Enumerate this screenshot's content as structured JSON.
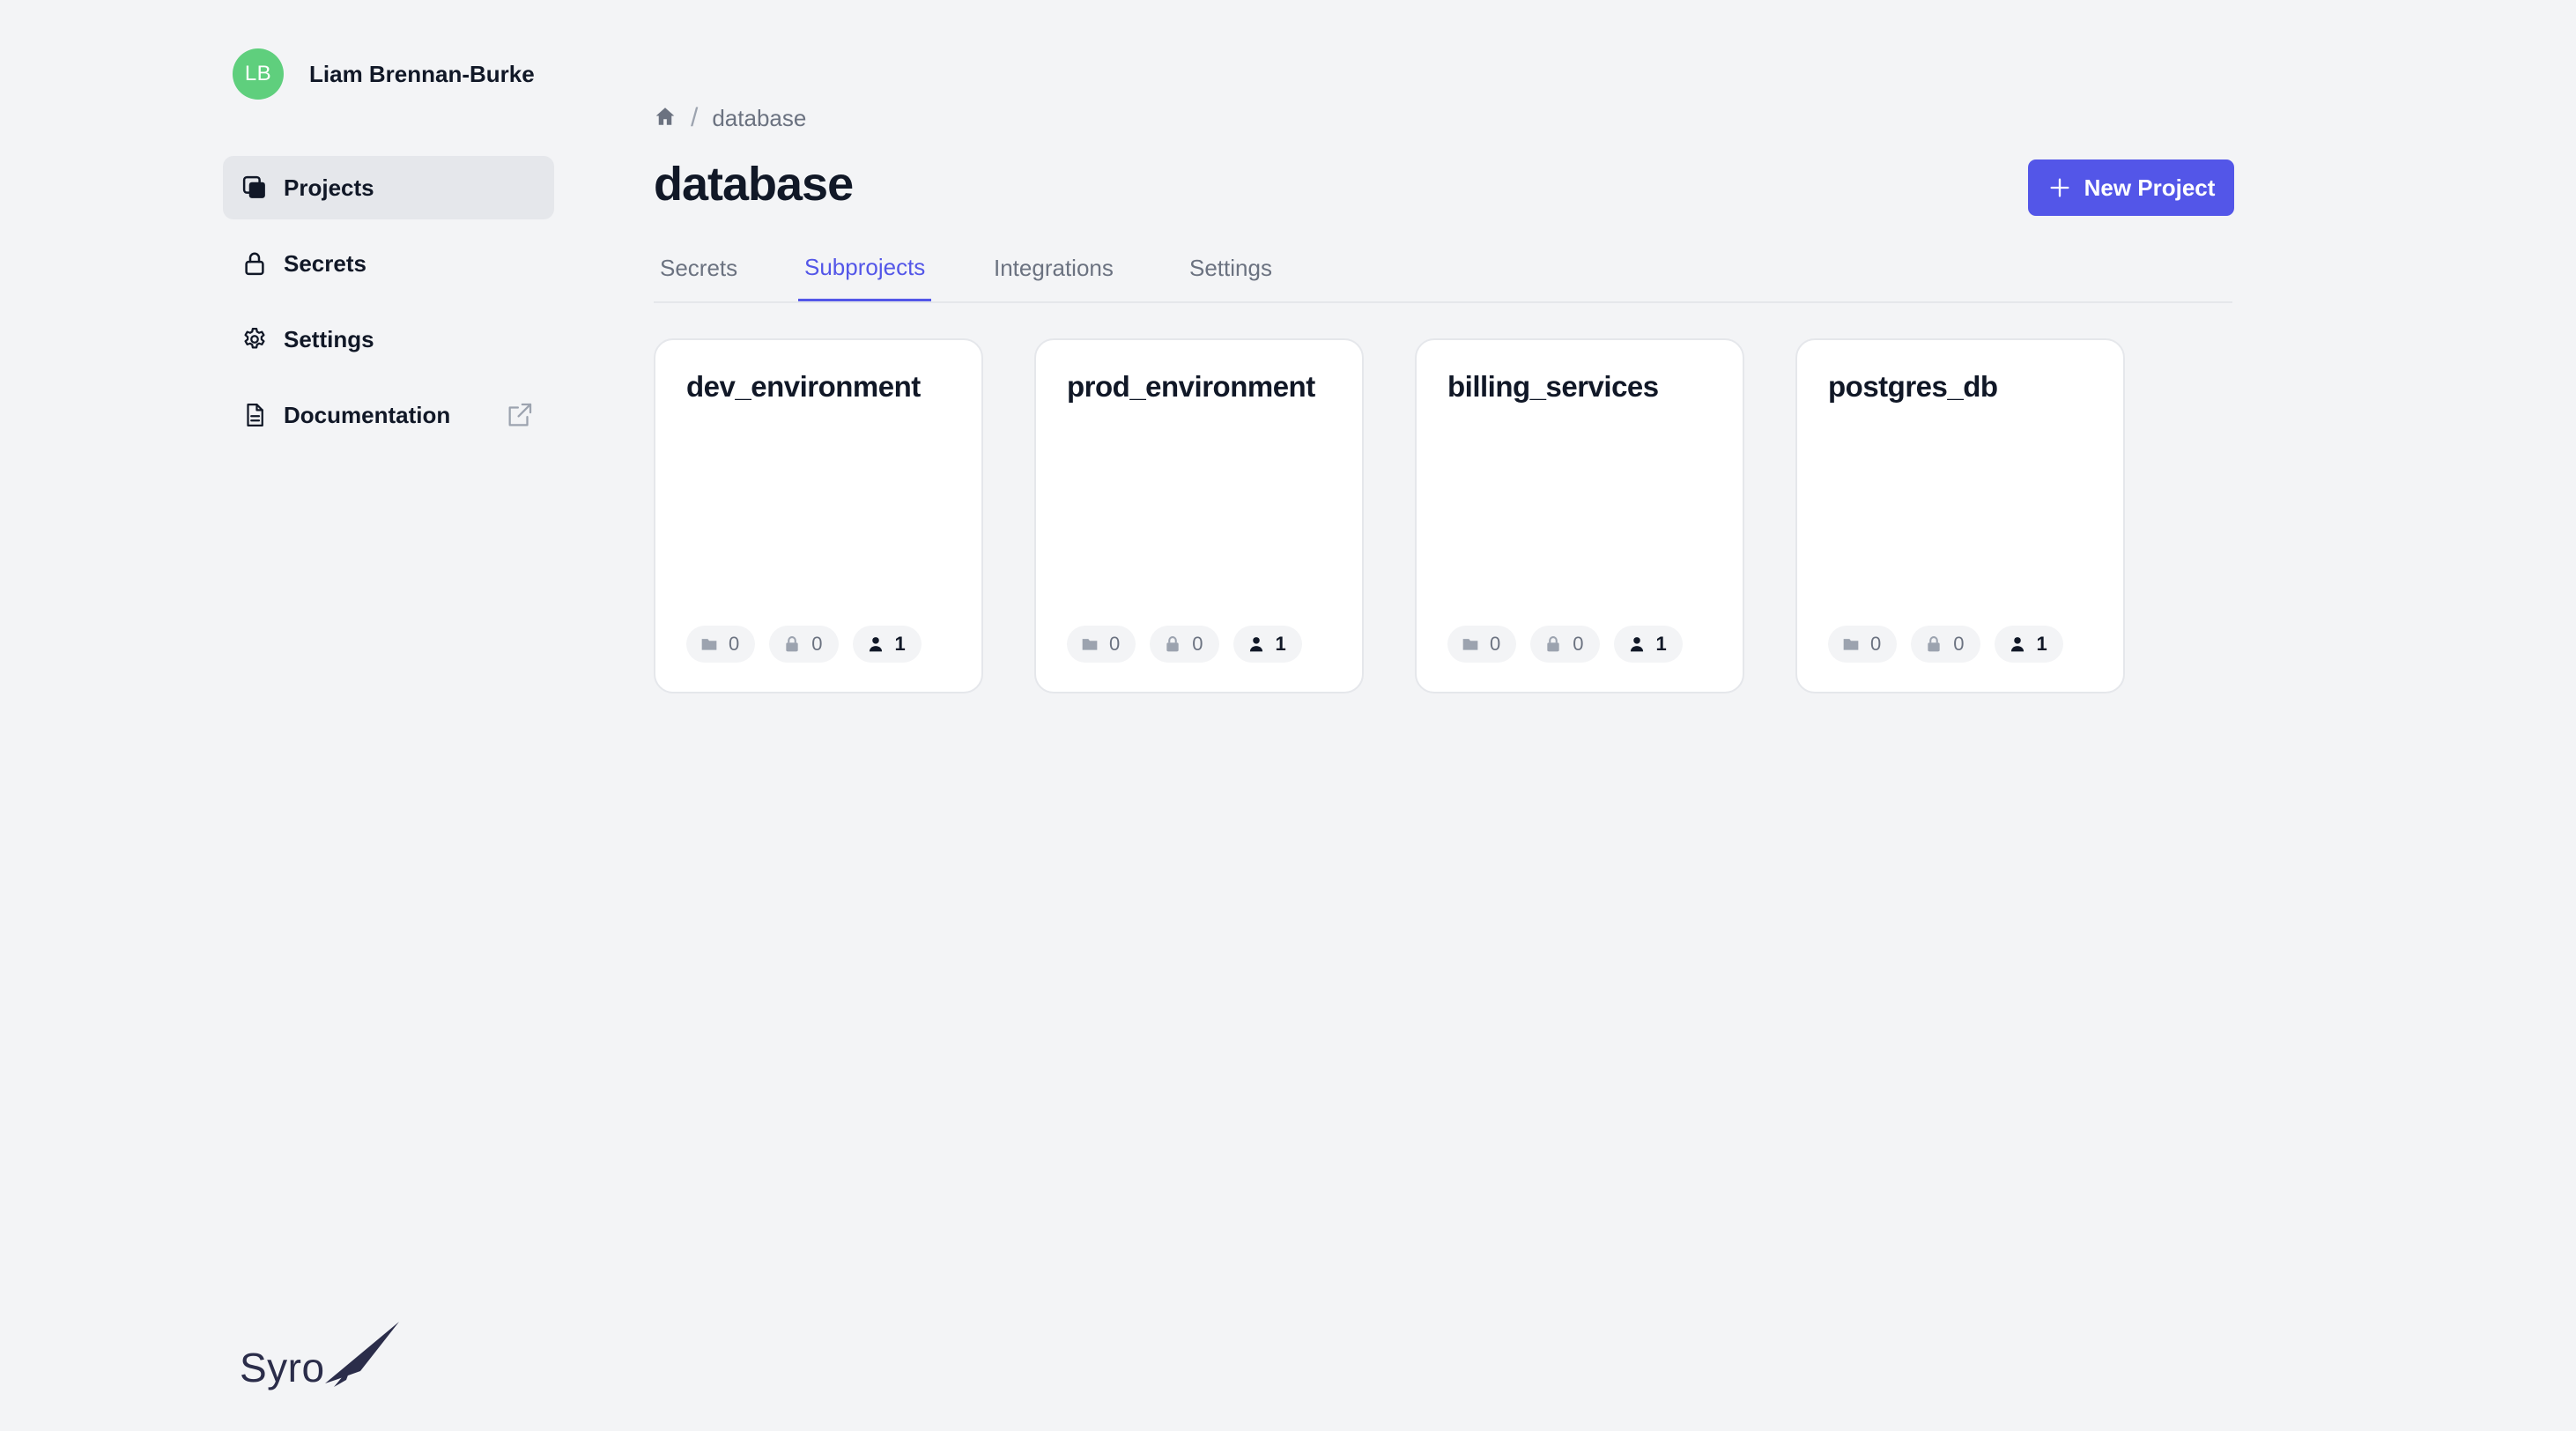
{
  "user": {
    "initials": "LB",
    "name": "Liam Brennan-Burke",
    "avatar_color": "#5fcf7d"
  },
  "sidebar": {
    "items": [
      {
        "label": "Projects",
        "icon": "projects-icon",
        "active": true
      },
      {
        "label": "Secrets",
        "icon": "lock-icon",
        "active": false
      },
      {
        "label": "Settings",
        "icon": "gear-icon",
        "active": false
      },
      {
        "label": "Documentation",
        "icon": "document-icon",
        "active": false,
        "trailing_icon": "external-link-icon"
      }
    ]
  },
  "logo": {
    "text": "Syro"
  },
  "breadcrumb": {
    "home_icon": "home-icon",
    "separator": "/",
    "current": "database"
  },
  "page": {
    "title": "database",
    "new_button_label": "New Project",
    "accent": "#5356e8"
  },
  "tabs": [
    {
      "label": "Secrets",
      "active": false
    },
    {
      "label": "Subprojects",
      "active": true
    },
    {
      "label": "Integrations",
      "active": false
    },
    {
      "label": "Settings",
      "active": false
    }
  ],
  "subprojects": [
    {
      "name": "dev_environment",
      "folders": "0",
      "secrets": "0",
      "members": "1"
    },
    {
      "name": "prod_environment",
      "folders": "0",
      "secrets": "0",
      "members": "1"
    },
    {
      "name": "billing_services",
      "folders": "0",
      "secrets": "0",
      "members": "1"
    },
    {
      "name": "postgres_db",
      "folders": "0",
      "secrets": "0",
      "members": "1"
    }
  ]
}
